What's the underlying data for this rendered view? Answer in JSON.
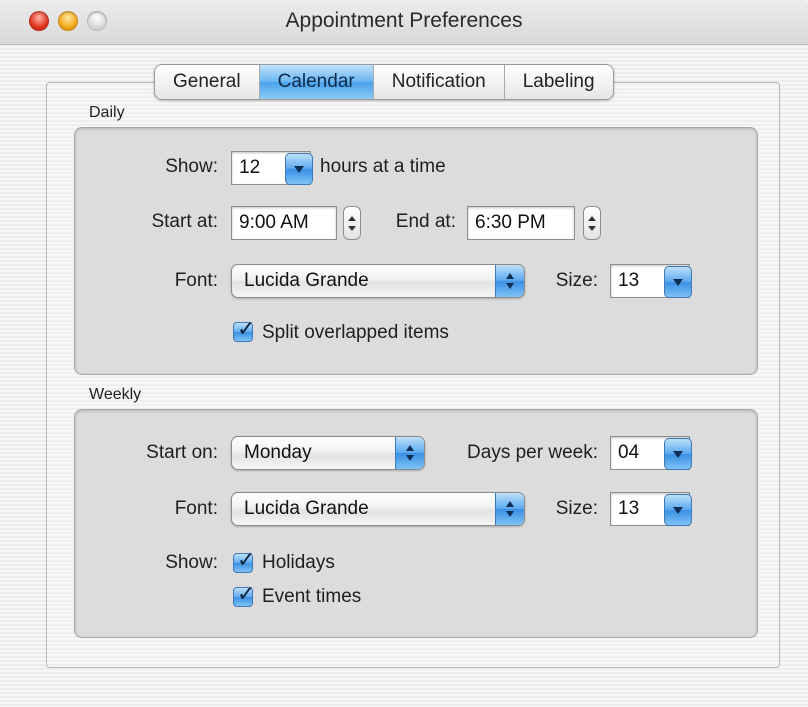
{
  "window": {
    "title": "Appointment Preferences"
  },
  "tabs": [
    {
      "label": "General",
      "active": false
    },
    {
      "label": "Calendar",
      "active": true
    },
    {
      "label": "Notification",
      "active": false
    },
    {
      "label": "Labeling",
      "active": false
    }
  ],
  "daily": {
    "section_label": "Daily",
    "show_label": "Show:",
    "show_value": "12",
    "show_suffix": "hours at a time",
    "start_label": "Start at:",
    "start_value": "9:00 AM",
    "end_label": "End at:",
    "end_value": "6:30 PM",
    "font_label": "Font:",
    "font_value": "Lucida Grande",
    "size_label": "Size:",
    "size_value": "13",
    "split_label": "Split overlapped items",
    "split_checked": true
  },
  "weekly": {
    "section_label": "Weekly",
    "start_on_label": "Start on:",
    "start_on_value": "Monday",
    "days_label": "Days per week:",
    "days_value": "04",
    "font_label": "Font:",
    "font_value": "Lucida Grande",
    "size_label": "Size:",
    "size_value": "13",
    "show_label": "Show:",
    "holidays_label": "Holidays",
    "holidays_checked": true,
    "event_times_label": "Event times",
    "event_times_checked": true
  },
  "colors": {
    "aqua_blue": "#4aa1ea",
    "close_red": "#e2361f",
    "minimize_yellow": "#f2a91d",
    "zoom_gray": "#d6d6d6",
    "group_fill": "#dcdcdc"
  }
}
